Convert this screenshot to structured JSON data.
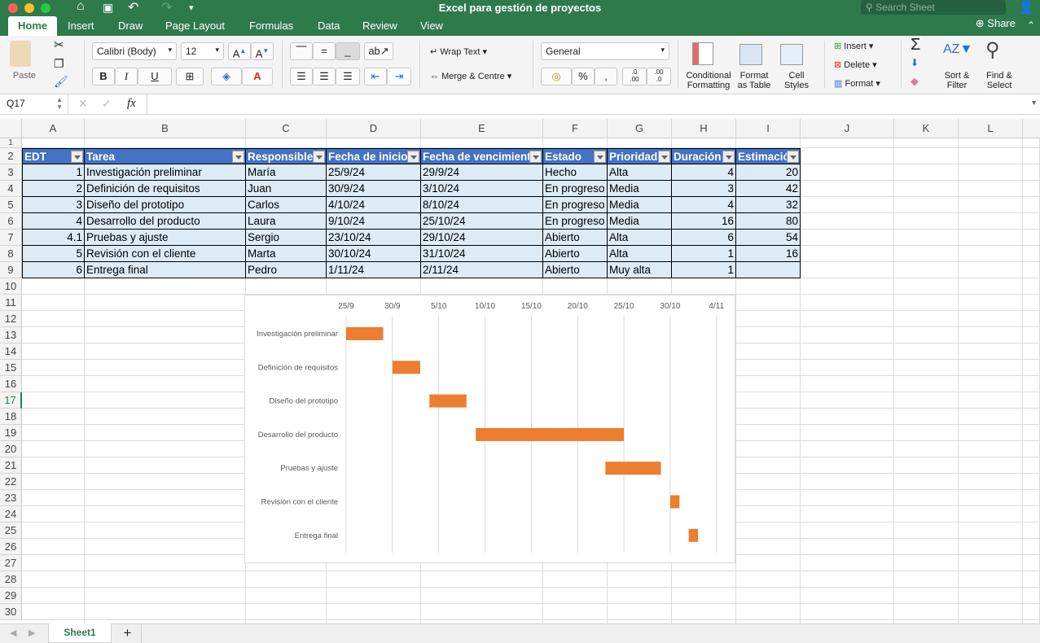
{
  "window": {
    "title": "Excel para gestión de proyectos",
    "search_placeholder": "Search Sheet",
    "share": "Share"
  },
  "tabs": [
    "Home",
    "Insert",
    "Draw",
    "Page Layout",
    "Formulas",
    "Data",
    "Review",
    "View"
  ],
  "ribbon": {
    "paste": "Paste",
    "font_name": "Calibri (Body)",
    "font_size": "12",
    "bold": "B",
    "italic": "I",
    "underline": "U",
    "wrap_text": "Wrap Text",
    "merge": "Merge & Centre",
    "number_format": "General",
    "percent": "%",
    "conditional": [
      "Conditional",
      "Formatting"
    ],
    "format_table": [
      "Format",
      "as Table"
    ],
    "cell_styles": [
      "Cell",
      "Styles"
    ],
    "insert": "Insert",
    "delete": "Delete",
    "format": "Format",
    "sort": [
      "Sort &",
      "Filter"
    ],
    "find": [
      "Find &",
      "Select"
    ]
  },
  "formula_bar": {
    "name_box": "Q17",
    "fx": "fx",
    "value": ""
  },
  "grid": {
    "columns": [
      "A",
      "B",
      "C",
      "D",
      "E",
      "F",
      "G",
      "H",
      "I",
      "J",
      "K",
      "L"
    ],
    "rows": 30,
    "selected_row": 17
  },
  "table": {
    "headers": [
      "EDT",
      "Tarea",
      "Responsible",
      "Fecha de inicio",
      "Fecha de vencimiento",
      "Estado",
      "Prioridad",
      "Duración",
      "Estimación"
    ],
    "rows": [
      [
        "1",
        "Investigación preliminar",
        "María",
        "25/9/24",
        "29/9/24",
        "Hecho",
        "Alta",
        "4",
        "20"
      ],
      [
        "2",
        "Definición de requisitos",
        "Juan",
        "30/9/24",
        "3/10/24",
        "En progreso",
        "Media",
        "3",
        "42"
      ],
      [
        "3",
        "Diseño del prototipo",
        "Carlos",
        "4/10/24",
        "8/10/24",
        "En progreso",
        "Media",
        "4",
        "32"
      ],
      [
        "4",
        "Desarrollo del producto",
        "Laura",
        "9/10/24",
        "25/10/24",
        "En progreso",
        "Media",
        "16",
        "80"
      ],
      [
        "4.1",
        "Pruebas y ajuste",
        "Sergio",
        "23/10/24",
        "29/10/24",
        "Abierto",
        "Alta",
        "6",
        "54"
      ],
      [
        "5",
        "Revisión con el cliente",
        "Marta",
        "30/10/24",
        "31/10/24",
        "Abierto",
        "Alta",
        "1",
        "16"
      ],
      [
        "6",
        "Entrega final",
        "Pedro",
        "1/11/24",
        "2/11/24",
        "Abierto",
        "Muy alta",
        "1",
        ""
      ]
    ],
    "numeric_columns": [
      0,
      7,
      8
    ],
    "header_color": "#4472c4",
    "band_color": "#ddebf7"
  },
  "chart_data": {
    "type": "bar",
    "subtype": "gantt (horizontal stacked bar, start offset hidden)",
    "categories": [
      "Investigación preliminar",
      "Definición de requisitos",
      "Diseño del prototipo",
      "Desarrollo del producto",
      "Pruebas y ajuste",
      "Revisión con el cliente",
      "Entrega final"
    ],
    "start": [
      "2024-09-25",
      "2024-09-30",
      "2024-10-04",
      "2024-10-09",
      "2024-10-23",
      "2024-10-30",
      "2024-11-01"
    ],
    "duration_days": [
      4,
      3,
      4,
      16,
      6,
      1,
      1
    ],
    "x_ticks": [
      "2024-09-25",
      "2024-09-30",
      "2024-10-05",
      "2024-10-10",
      "2024-10-15",
      "2024-10-20",
      "2024-10-25",
      "2024-10-30",
      "2024-11-04"
    ],
    "x_tick_labels": [
      "25/9",
      "30/9",
      "5/10",
      "10/10",
      "15/10",
      "20/10",
      "25/10",
      "30/10",
      "4/11"
    ],
    "xlim": [
      "2024-09-25",
      "2024-11-05"
    ],
    "axis_position": "top",
    "grid": true,
    "bar_color": "#ed7d31",
    "title": "",
    "xlabel": "",
    "ylabel": ""
  },
  "sheets": [
    "Sheet1"
  ],
  "add_sheet": "+"
}
